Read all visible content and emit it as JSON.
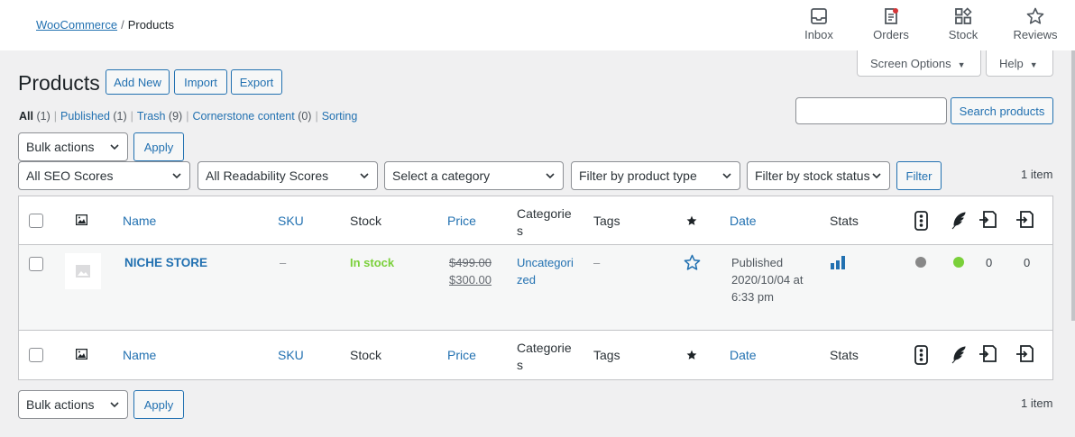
{
  "breadcrumb": {
    "home": "WooCommerce",
    "sep": "/",
    "current": "Products"
  },
  "topnav": [
    {
      "label": "Inbox",
      "icon": "inbox-icon"
    },
    {
      "label": "Orders",
      "icon": "orders-icon"
    },
    {
      "label": "Stock",
      "icon": "stock-icon"
    },
    {
      "label": "Reviews",
      "icon": "star-icon"
    }
  ],
  "tabs": {
    "screen_options": "Screen Options",
    "help": "Help"
  },
  "page": {
    "title": "Products",
    "add_new": "Add New",
    "import": "Import",
    "export": "Export"
  },
  "views": [
    {
      "label": "All",
      "count": "(1)"
    },
    {
      "label": "Published",
      "count": "(1)"
    },
    {
      "label": "Trash",
      "count": "(9)"
    },
    {
      "label": "Cornerstone content",
      "count": "(0)"
    },
    {
      "label": "Sorting",
      "count": ""
    }
  ],
  "search": {
    "value": "",
    "button": "Search products"
  },
  "bulk": {
    "label": "Bulk actions",
    "apply": "Apply"
  },
  "filters": {
    "seo": "All SEO Scores",
    "readability": "All Readability Scores",
    "category": "Select a category",
    "product_type": "Filter by product type",
    "stock_status": "Filter by stock status",
    "button": "Filter"
  },
  "items_count": "1 item",
  "columns": {
    "name": "Name",
    "sku": "SKU",
    "stock": "Stock",
    "price": "Price",
    "categories": "Categorie s",
    "tags": "Tags",
    "date": "Date",
    "stats": "Stats"
  },
  "rows": [
    {
      "name": "NICHE STORE",
      "sku": "–",
      "stock": "In stock",
      "price_old": "$499.00",
      "price_new": "$300.00",
      "category": "Uncategori zed",
      "tags": "–",
      "date_status": "Published",
      "date_line1": "2020/10/04 at",
      "date_line2": "6:33 pm",
      "links_out": "0",
      "links_in": "0",
      "seo_color": "#888888",
      "readability_color": "#7ad03a"
    }
  ],
  "colors": {
    "accent": "#2271b1",
    "in_stock": "#7ad03a",
    "text": "#3c434a"
  }
}
